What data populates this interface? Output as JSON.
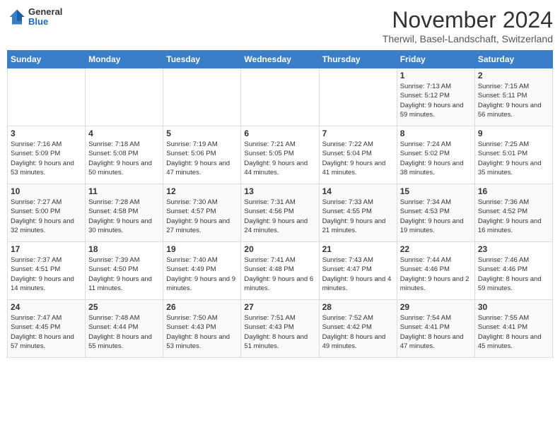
{
  "logo": {
    "general": "General",
    "blue": "Blue"
  },
  "title": "November 2024",
  "subtitle": "Therwil, Basel-Landschaft, Switzerland",
  "weekdays": [
    "Sunday",
    "Monday",
    "Tuesday",
    "Wednesday",
    "Thursday",
    "Friday",
    "Saturday"
  ],
  "weeks": [
    [
      {
        "day": "",
        "info": ""
      },
      {
        "day": "",
        "info": ""
      },
      {
        "day": "",
        "info": ""
      },
      {
        "day": "",
        "info": ""
      },
      {
        "day": "",
        "info": ""
      },
      {
        "day": "1",
        "info": "Sunrise: 7:13 AM\nSunset: 5:12 PM\nDaylight: 9 hours and 59 minutes."
      },
      {
        "day": "2",
        "info": "Sunrise: 7:15 AM\nSunset: 5:11 PM\nDaylight: 9 hours and 56 minutes."
      }
    ],
    [
      {
        "day": "3",
        "info": "Sunrise: 7:16 AM\nSunset: 5:09 PM\nDaylight: 9 hours and 53 minutes."
      },
      {
        "day": "4",
        "info": "Sunrise: 7:18 AM\nSunset: 5:08 PM\nDaylight: 9 hours and 50 minutes."
      },
      {
        "day": "5",
        "info": "Sunrise: 7:19 AM\nSunset: 5:06 PM\nDaylight: 9 hours and 47 minutes."
      },
      {
        "day": "6",
        "info": "Sunrise: 7:21 AM\nSunset: 5:05 PM\nDaylight: 9 hours and 44 minutes."
      },
      {
        "day": "7",
        "info": "Sunrise: 7:22 AM\nSunset: 5:04 PM\nDaylight: 9 hours and 41 minutes."
      },
      {
        "day": "8",
        "info": "Sunrise: 7:24 AM\nSunset: 5:02 PM\nDaylight: 9 hours and 38 minutes."
      },
      {
        "day": "9",
        "info": "Sunrise: 7:25 AM\nSunset: 5:01 PM\nDaylight: 9 hours and 35 minutes."
      }
    ],
    [
      {
        "day": "10",
        "info": "Sunrise: 7:27 AM\nSunset: 5:00 PM\nDaylight: 9 hours and 32 minutes."
      },
      {
        "day": "11",
        "info": "Sunrise: 7:28 AM\nSunset: 4:58 PM\nDaylight: 9 hours and 30 minutes."
      },
      {
        "day": "12",
        "info": "Sunrise: 7:30 AM\nSunset: 4:57 PM\nDaylight: 9 hours and 27 minutes."
      },
      {
        "day": "13",
        "info": "Sunrise: 7:31 AM\nSunset: 4:56 PM\nDaylight: 9 hours and 24 minutes."
      },
      {
        "day": "14",
        "info": "Sunrise: 7:33 AM\nSunset: 4:55 PM\nDaylight: 9 hours and 21 minutes."
      },
      {
        "day": "15",
        "info": "Sunrise: 7:34 AM\nSunset: 4:53 PM\nDaylight: 9 hours and 19 minutes."
      },
      {
        "day": "16",
        "info": "Sunrise: 7:36 AM\nSunset: 4:52 PM\nDaylight: 9 hours and 16 minutes."
      }
    ],
    [
      {
        "day": "17",
        "info": "Sunrise: 7:37 AM\nSunset: 4:51 PM\nDaylight: 9 hours and 14 minutes."
      },
      {
        "day": "18",
        "info": "Sunrise: 7:39 AM\nSunset: 4:50 PM\nDaylight: 9 hours and 11 minutes."
      },
      {
        "day": "19",
        "info": "Sunrise: 7:40 AM\nSunset: 4:49 PM\nDaylight: 9 hours and 9 minutes."
      },
      {
        "day": "20",
        "info": "Sunrise: 7:41 AM\nSunset: 4:48 PM\nDaylight: 9 hours and 6 minutes."
      },
      {
        "day": "21",
        "info": "Sunrise: 7:43 AM\nSunset: 4:47 PM\nDaylight: 9 hours and 4 minutes."
      },
      {
        "day": "22",
        "info": "Sunrise: 7:44 AM\nSunset: 4:46 PM\nDaylight: 9 hours and 2 minutes."
      },
      {
        "day": "23",
        "info": "Sunrise: 7:46 AM\nSunset: 4:46 PM\nDaylight: 8 hours and 59 minutes."
      }
    ],
    [
      {
        "day": "24",
        "info": "Sunrise: 7:47 AM\nSunset: 4:45 PM\nDaylight: 8 hours and 57 minutes."
      },
      {
        "day": "25",
        "info": "Sunrise: 7:48 AM\nSunset: 4:44 PM\nDaylight: 8 hours and 55 minutes."
      },
      {
        "day": "26",
        "info": "Sunrise: 7:50 AM\nSunset: 4:43 PM\nDaylight: 8 hours and 53 minutes."
      },
      {
        "day": "27",
        "info": "Sunrise: 7:51 AM\nSunset: 4:43 PM\nDaylight: 8 hours and 51 minutes."
      },
      {
        "day": "28",
        "info": "Sunrise: 7:52 AM\nSunset: 4:42 PM\nDaylight: 8 hours and 49 minutes."
      },
      {
        "day": "29",
        "info": "Sunrise: 7:54 AM\nSunset: 4:41 PM\nDaylight: 8 hours and 47 minutes."
      },
      {
        "day": "30",
        "info": "Sunrise: 7:55 AM\nSunset: 4:41 PM\nDaylight: 8 hours and 45 minutes."
      }
    ]
  ]
}
